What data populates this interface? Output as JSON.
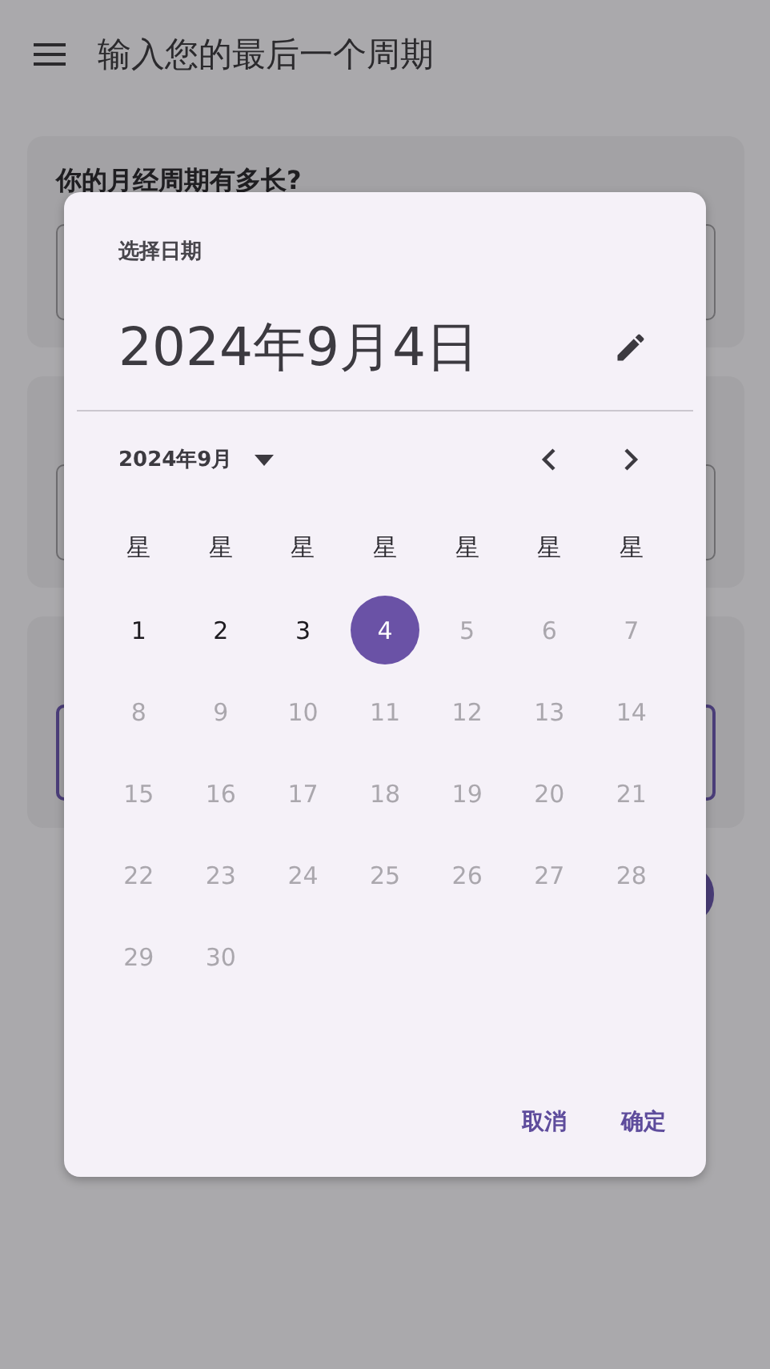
{
  "app_bar": {
    "title": "输入您的最后一个周期"
  },
  "cards": [
    {
      "label": "你的月经周期有多长?",
      "field": {
        "focused": false
      }
    },
    {
      "field": {
        "focused": false
      }
    },
    {
      "field": {
        "focused": true
      }
    }
  ],
  "date_picker": {
    "heading": "选择日期",
    "selected_date": "2024年9月4日",
    "month": "2024年9月",
    "weekdays": [
      "星",
      "星",
      "星",
      "星",
      "星",
      "星",
      "星"
    ],
    "days": [
      {
        "label": "1",
        "selected": false,
        "disabled": false
      },
      {
        "label": "2",
        "selected": false,
        "disabled": false
      },
      {
        "label": "3",
        "selected": false,
        "disabled": false
      },
      {
        "label": "4",
        "selected": true,
        "disabled": false
      },
      {
        "label": "5",
        "selected": false,
        "disabled": true
      },
      {
        "label": "6",
        "selected": false,
        "disabled": true
      },
      {
        "label": "7",
        "selected": false,
        "disabled": true
      },
      {
        "label": "8",
        "selected": false,
        "disabled": true
      },
      {
        "label": "9",
        "selected": false,
        "disabled": true
      },
      {
        "label": "10",
        "selected": false,
        "disabled": true
      },
      {
        "label": "11",
        "selected": false,
        "disabled": true
      },
      {
        "label": "12",
        "selected": false,
        "disabled": true
      },
      {
        "label": "13",
        "selected": false,
        "disabled": true
      },
      {
        "label": "14",
        "selected": false,
        "disabled": true
      },
      {
        "label": "15",
        "selected": false,
        "disabled": true
      },
      {
        "label": "16",
        "selected": false,
        "disabled": true
      },
      {
        "label": "17",
        "selected": false,
        "disabled": true
      },
      {
        "label": "18",
        "selected": false,
        "disabled": true
      },
      {
        "label": "19",
        "selected": false,
        "disabled": true
      },
      {
        "label": "20",
        "selected": false,
        "disabled": true
      },
      {
        "label": "21",
        "selected": false,
        "disabled": true
      },
      {
        "label": "22",
        "selected": false,
        "disabled": true
      },
      {
        "label": "23",
        "selected": false,
        "disabled": true
      },
      {
        "label": "24",
        "selected": false,
        "disabled": true
      },
      {
        "label": "25",
        "selected": false,
        "disabled": true
      },
      {
        "label": "26",
        "selected": false,
        "disabled": true
      },
      {
        "label": "27",
        "selected": false,
        "disabled": true
      },
      {
        "label": "28",
        "selected": false,
        "disabled": true
      },
      {
        "label": "29",
        "selected": false,
        "disabled": true
      },
      {
        "label": "30",
        "selected": false,
        "disabled": true
      }
    ],
    "actions": [
      "取消",
      "确定"
    ]
  }
}
